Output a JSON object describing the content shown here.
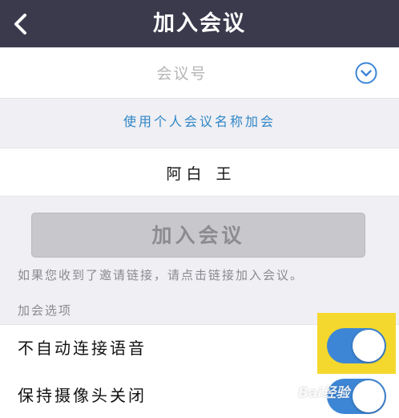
{
  "header": {
    "title": "加入会议",
    "back_icon": "chevron-left-icon",
    "background": "#3b3a4d"
  },
  "meeting_id": {
    "placeholder": "会议号",
    "value": "",
    "dropdown_icon": "chevron-down-circle-icon"
  },
  "use_name_link": "使用个人会议名称加会",
  "display_name": {
    "value": "阿白 王"
  },
  "join_button": {
    "label": "加入会议",
    "state": "disabled"
  },
  "hint_text": "如果您收到了邀请链接，请点击链接加入会议。",
  "options_section": {
    "label": "加会选项",
    "items": [
      {
        "label": "不自动连接语音",
        "toggle_on": true,
        "highlighted": true
      },
      {
        "label": "保持摄像头关闭",
        "toggle_on": true,
        "highlighted": false
      }
    ]
  },
  "colors": {
    "accent": "#3d86d6",
    "link": "#2f86c6",
    "highlight": "#f5d82e"
  },
  "watermark": "Bai经验"
}
